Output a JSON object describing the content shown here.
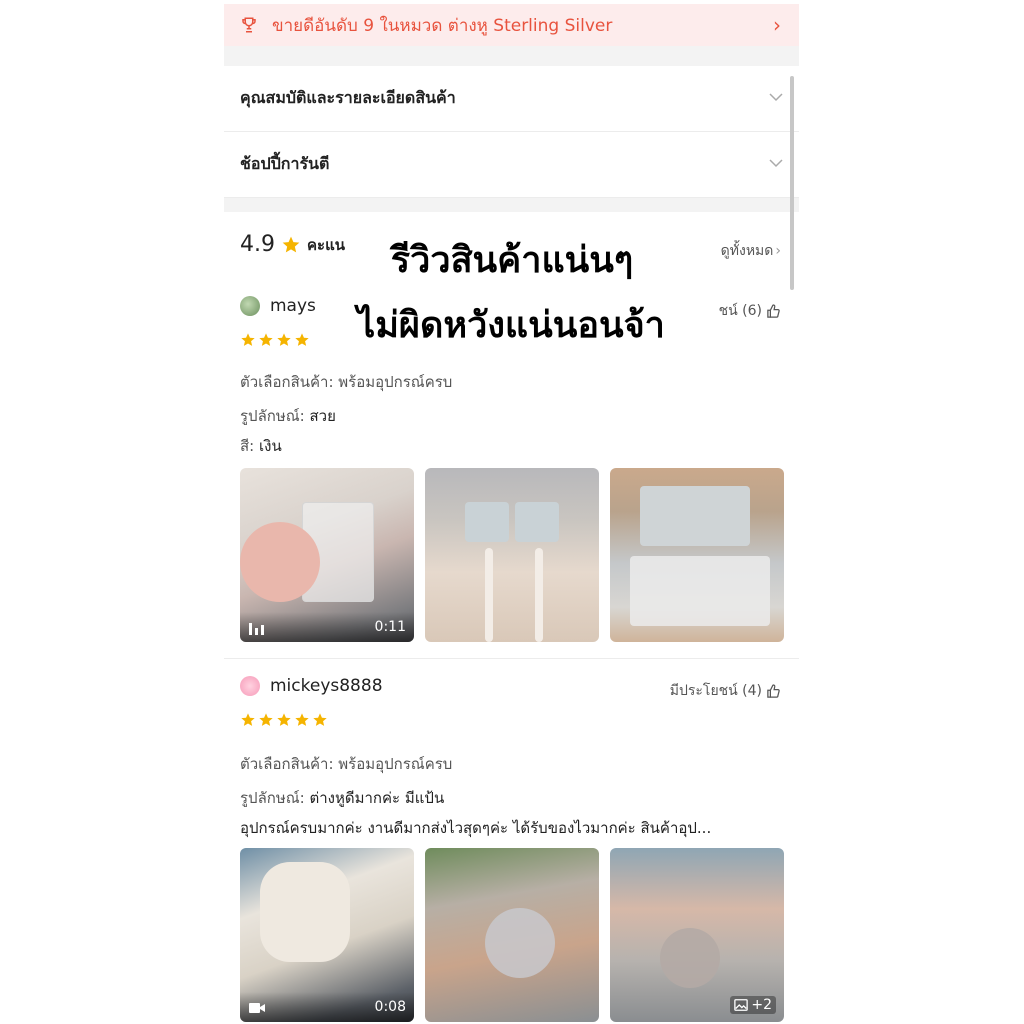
{
  "banner": {
    "text": "ขายดีอันดับ 9 ในหมวด ต่างหู Sterling Silver",
    "icon": "trophy-icon",
    "accent": "#e8533e"
  },
  "sections": {
    "specs_label": "คุณสมบัติและรายละเอียดสินค้า",
    "guarantee_label": "ช้อปปี้การันตี"
  },
  "ratings": {
    "score": "4.9",
    "label": "คะแน",
    "see_all": "ดูทั้งหมด"
  },
  "overlay": {
    "line1": "รีวิวสินค้าแน่นๆ",
    "line2": "ไม่ผิดหวังแน่นอนจ้า"
  },
  "reviews": [
    {
      "username": "mays",
      "helpful": "ชน์ (6)",
      "stars": 4,
      "option_label": "ตัวเลือกสินค้า:",
      "option_value": "พร้อมอุปกรณ์ครบ",
      "style_label": "รูปลักษณ์:",
      "style_value": "สวย",
      "color_label": "สี:",
      "color_value": "เงิน",
      "video_duration": "0:11"
    },
    {
      "username": "mickeys8888",
      "helpful": "มีประโยชน์ (4)",
      "stars": 5,
      "option_label": "ตัวเลือกสินค้า:",
      "option_value": "พร้อมอุปกรณ์ครบ",
      "style_label": "รูปลักษณ์:",
      "style_value": "ต่างหูดีมากค่ะ มีแป้น",
      "comment": "อุปกรณ์ครบมากค่ะ งานดีมากส่งไวสุดๆค่ะ ได้รับของไวมากค่ะ สินค้าอุป...",
      "video_duration": "0:08",
      "more_photos": "+2"
    }
  ],
  "colors": {
    "star": "#f5b400",
    "banner_bg": "#fdecec"
  }
}
